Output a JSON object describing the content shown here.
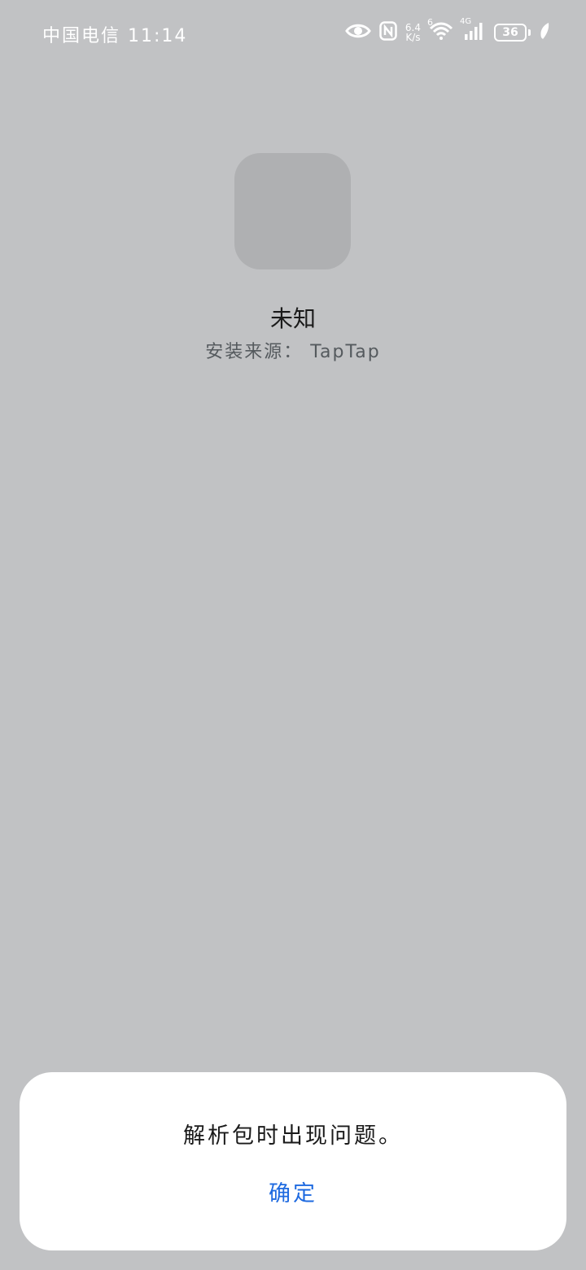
{
  "status_bar": {
    "carrier_time": "中国电信 11:14",
    "net_speed_value": "6.4",
    "net_speed_unit": "K/s",
    "wifi_badge": "6",
    "cell_badge": "4G",
    "battery_level": "36",
    "icons": [
      "eye-icon",
      "nfc-icon",
      "wifi-icon",
      "signal-icon",
      "battery-icon",
      "leaf-icon"
    ]
  },
  "app": {
    "name": "未知",
    "install_source": "安装来源：  TapTap"
  },
  "dialog": {
    "message": "解析包时出现问题。",
    "confirm_label": "确定"
  },
  "colors": {
    "background": "#c1c2c4",
    "icon_placeholder": "#afb0b2",
    "dialog": "#ffffff",
    "accent": "#1e6ae0"
  }
}
